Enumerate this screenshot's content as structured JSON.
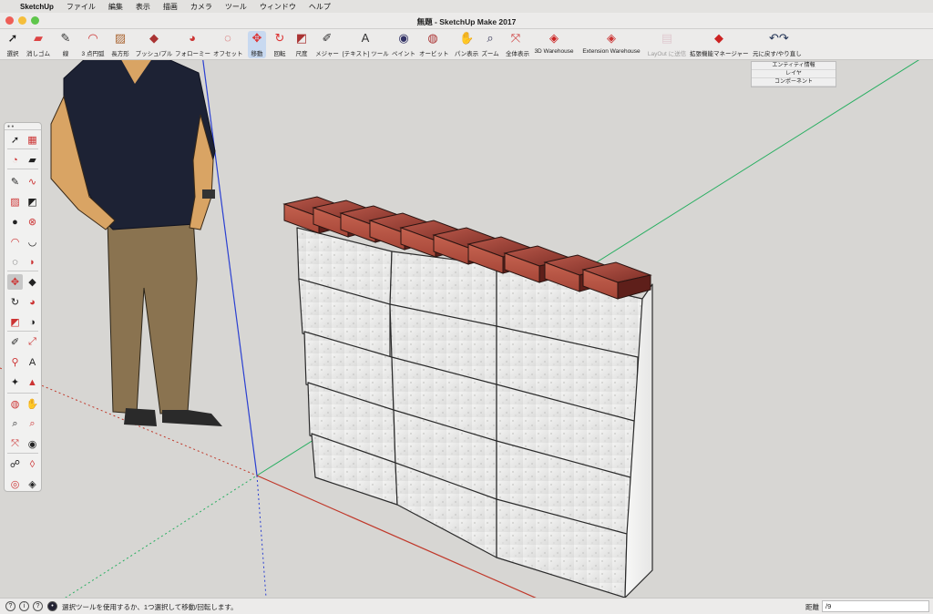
{
  "menubar": {
    "app_name": "SketchUp",
    "items": [
      "ファイル",
      "編集",
      "表示",
      "描画",
      "カメラ",
      "ツール",
      "ウィンドウ",
      "ヘルプ"
    ]
  },
  "window": {
    "title": "無題 - SketchUp Make 2017"
  },
  "toolbar": {
    "items": [
      {
        "label": "選択",
        "icon": "select-arrow-icon",
        "glyph": "➚"
      },
      {
        "label": "消しゴム",
        "icon": "eraser-icon",
        "glyph": "▰"
      },
      {
        "label": "線",
        "icon": "pencil-icon",
        "glyph": "✎"
      },
      {
        "label": "3 点円弧",
        "icon": "arc-icon",
        "glyph": "◠"
      },
      {
        "label": "長方形",
        "icon": "rectangle-icon",
        "glyph": "▨"
      },
      {
        "label": "プッシュ/プル",
        "icon": "push-pull-icon",
        "glyph": "◆"
      },
      {
        "label": "フォローミー",
        "icon": "follow-me-icon",
        "glyph": "◕"
      },
      {
        "label": "オフセット",
        "icon": "offset-icon",
        "glyph": "◌"
      },
      {
        "label": "移動",
        "icon": "move-icon",
        "glyph": "✥"
      },
      {
        "label": "回転",
        "icon": "rotate-icon",
        "glyph": "↻"
      },
      {
        "label": "尺度",
        "icon": "scale-icon",
        "glyph": "◩"
      },
      {
        "label": "メジャー",
        "icon": "tape-measure-icon",
        "glyph": "✐"
      },
      {
        "label": "[テキスト] ツール",
        "icon": "text-tool-icon",
        "glyph": "A"
      },
      {
        "label": "ペイント",
        "icon": "paint-bucket-icon",
        "glyph": "◉"
      },
      {
        "label": "オービット",
        "icon": "orbit-icon",
        "glyph": "◍"
      },
      {
        "label": "パン表示",
        "icon": "pan-icon",
        "glyph": "✋"
      },
      {
        "label": "ズーム",
        "icon": "zoom-icon",
        "glyph": "⌕"
      },
      {
        "label": "全体表示",
        "icon": "zoom-extents-icon",
        "glyph": "⤧"
      },
      {
        "label": "3D Warehouse",
        "icon": "warehouse-icon",
        "glyph": "◈"
      },
      {
        "label": "Extension Warehouse",
        "icon": "extension-warehouse-icon",
        "glyph": "◈"
      },
      {
        "label": "LayOut に送信",
        "icon": "send-to-layout-icon",
        "glyph": "▤"
      },
      {
        "label": "拡張機能マネージャー",
        "icon": "extension-manager-icon",
        "glyph": "◆"
      },
      {
        "label": "元に戻す/やり直し",
        "icon": "undo-redo-icon",
        "glyph": "↶↷"
      }
    ]
  },
  "tray": {
    "rows": [
      "エンティティ情報",
      "レイヤ",
      "コンポーネント"
    ]
  },
  "statusbar": {
    "message": "選択ツールを使用するか、1つ選択して移動/回転します。",
    "distance_label": "距離",
    "distance_value": "/9"
  },
  "colors": {
    "viewport_bg": "#d7d6d3",
    "axis_red": "#c0392b",
    "axis_green": "#27ae60",
    "axis_blue": "#2a3fd1",
    "brick": "#a9473a",
    "block": "#ebebea"
  }
}
